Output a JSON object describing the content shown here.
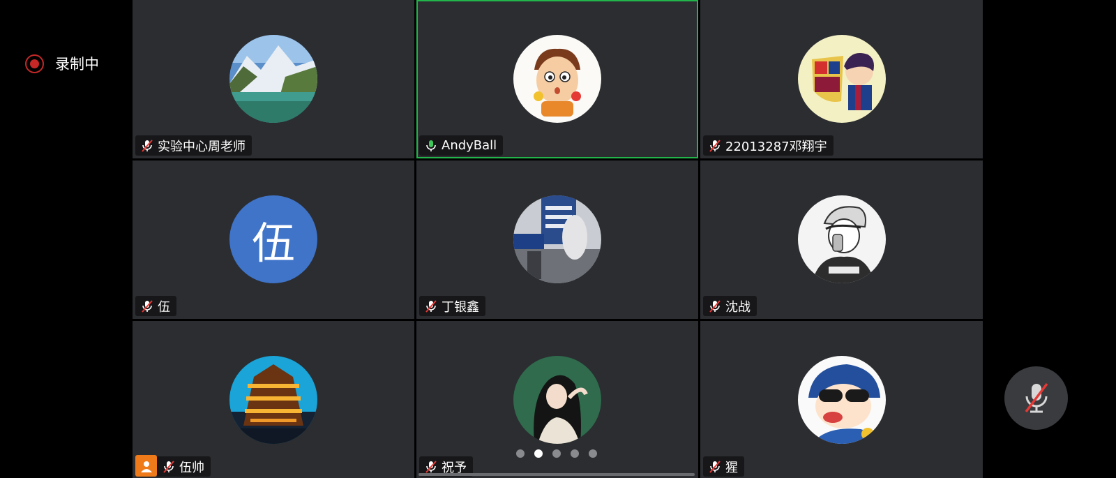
{
  "recording": {
    "label": "录制中"
  },
  "participants": [
    {
      "name": "实验中心周老师",
      "mic": "muted",
      "avatar": "mountain-lake-photo"
    },
    {
      "name": "AndyBall",
      "mic": "active",
      "avatar": "cartoon-boy-avatar",
      "active_speaker": true
    },
    {
      "name": "22013287邓翔宇",
      "mic": "muted",
      "avatar": "fcb-cartoon-avatar"
    },
    {
      "name": "伍",
      "mic": "muted",
      "avatar_text": "伍"
    },
    {
      "name": "丁银鑫",
      "mic": "muted",
      "avatar": "station-photo"
    },
    {
      "name": "沈战",
      "mic": "muted",
      "avatar": "sketch-person-avatar"
    },
    {
      "name": "伍帅",
      "mic": "muted",
      "avatar": "night-building-photo",
      "host": true
    },
    {
      "name": "祝予",
      "mic": "muted",
      "avatar": "girl-illustration-avatar"
    },
    {
      "name": "猩",
      "mic": "muted",
      "avatar": "crayon-shin-chan-avatar"
    }
  ],
  "pagination": {
    "pages": 5,
    "current": 2
  },
  "colors": {
    "active_border": "#21b54a",
    "recording": "#c62828",
    "tile_bg": "#2b2d31",
    "host_badge": "#ef7a1a",
    "text_avatar_bg": "#3f74c9"
  },
  "controls": {
    "mic_button": "mic-off-icon"
  }
}
